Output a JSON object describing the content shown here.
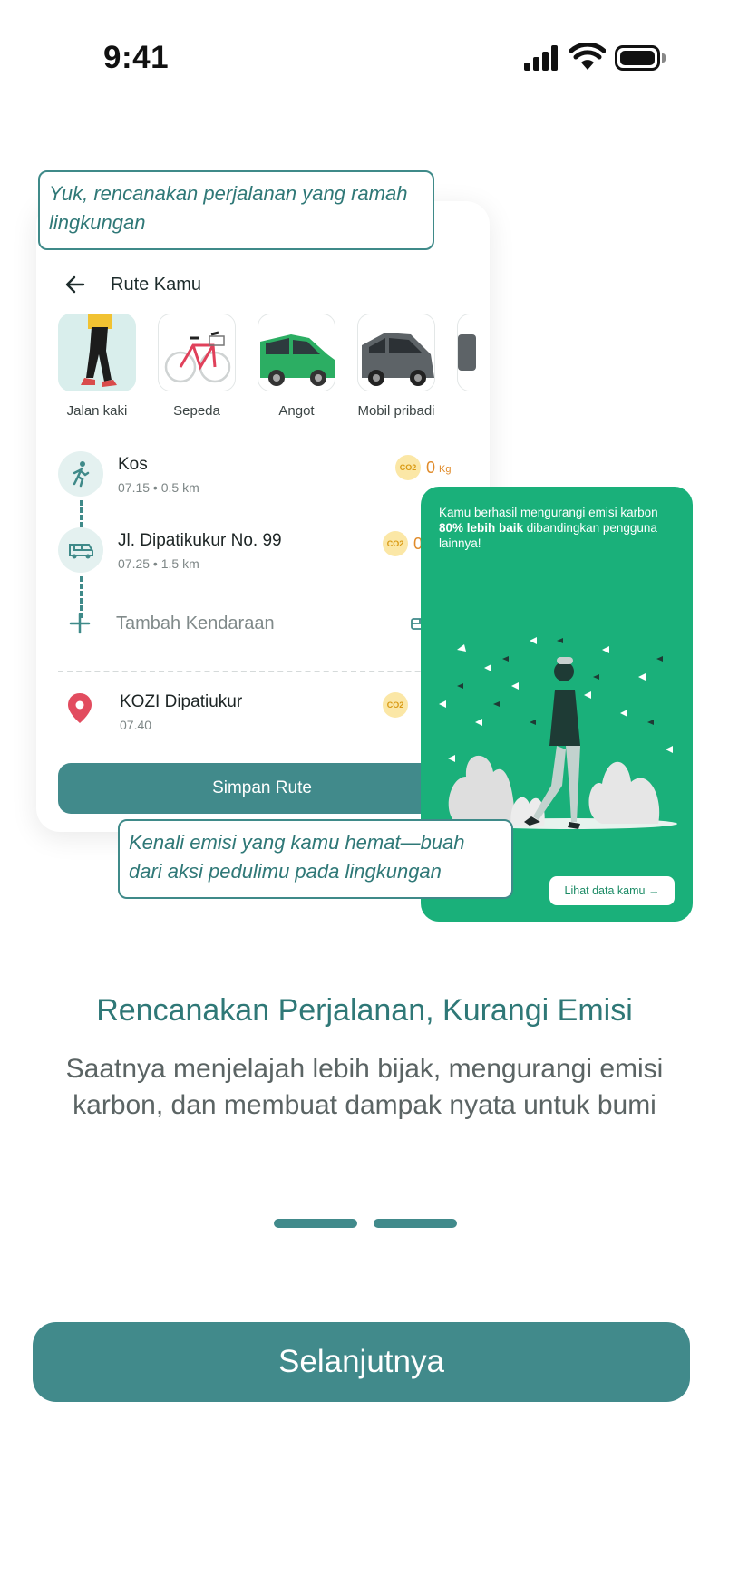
{
  "status_bar": {
    "time": "9:41"
  },
  "callouts": {
    "plan": "Yuk, rencanakan perjalanan yang ramah lingkungan",
    "emission": "Kenali emisi yang kamu hemat—buah dari aksi pedulimu pada lingkungan"
  },
  "route_card": {
    "title": "Rute Kamu",
    "vehicles": [
      {
        "label": "Jalan kaki",
        "icon": "walking-person-image",
        "selected": true
      },
      {
        "label": "Sepeda",
        "icon": "bicycle-image",
        "selected": false
      },
      {
        "label": "Angot",
        "icon": "green-minibus-image",
        "selected": false
      },
      {
        "label": "Mobil pribadi",
        "icon": "private-car-image",
        "selected": false
      }
    ],
    "stops": [
      {
        "name": "Kos",
        "detail": "07.15 • 0.5 km",
        "co2_badge": "CO2",
        "co2_value": "0",
        "co2_unit": "Kg",
        "icon": "walking-icon"
      },
      {
        "name": "Jl. Dipatikukur No. 99",
        "detail": "07.25 • 1.5 km",
        "co2_badge": "CO2",
        "co2_value": "0",
        "icon": "minibus-icon"
      }
    ],
    "add_vehicle_label": "Tambah Kendaraan",
    "destination": {
      "name": "KOZI Dipatiukur",
      "time": "07.40",
      "co2_badge": "CO2",
      "icon": "location-pin-icon"
    },
    "save_button": "Simpan Rute"
  },
  "emission_card": {
    "text_before": "Kamu berhasil mengurangi emisi karbon ",
    "text_bold": "80% lebih baik",
    "text_after": " dibandingkan pengguna lainnya!",
    "button": "Lihat data kamu →",
    "bg_color": "#1ab07a"
  },
  "onboarding": {
    "headline": "Rencanakan Perjalanan, Kurangi Emisi",
    "description": "Saatnya menjelajah lebih bijak, mengurangi emisi karbon, dan membuat dampak nyata untuk bumi",
    "page_indicators": 2,
    "next_button": "Selanjutnya"
  },
  "colors": {
    "primary": "#418a8b",
    "accent_text": "#2f7877",
    "co2_badge": "#fbe7a6",
    "co2_text": "#e08b2a"
  }
}
